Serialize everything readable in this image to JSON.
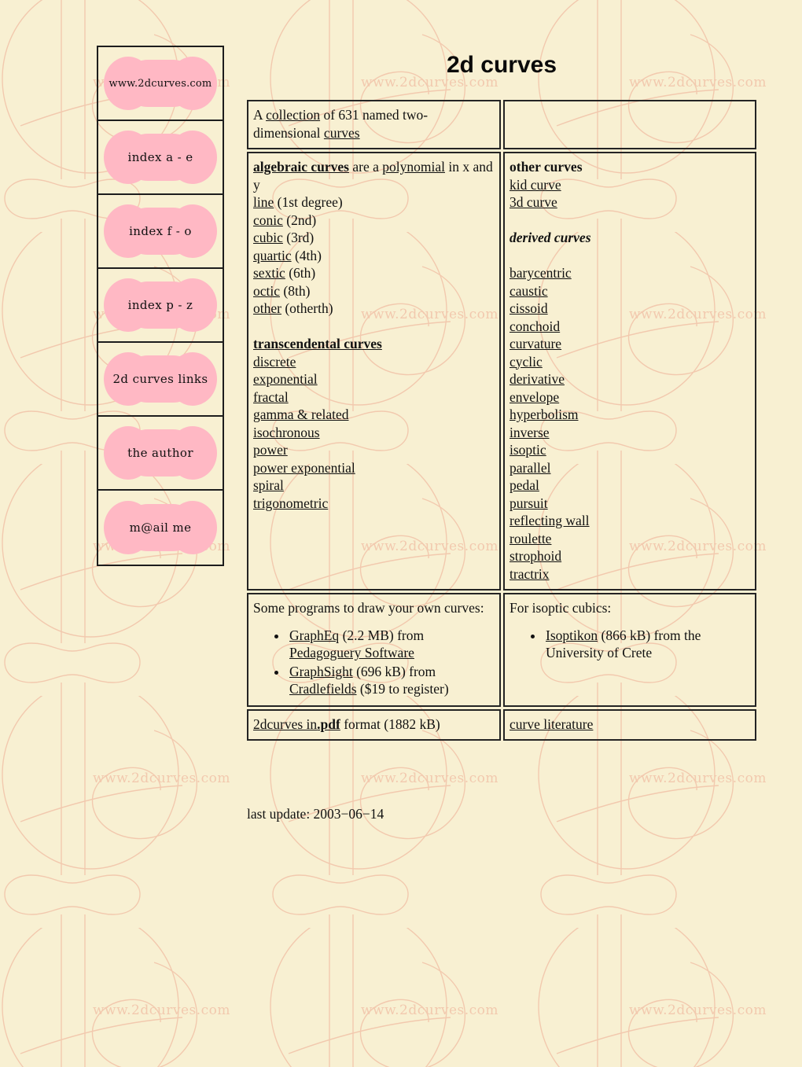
{
  "header": {
    "title": "2d curves"
  },
  "sidebar": {
    "items": [
      {
        "label": "www.2dcurves.com",
        "name": "home"
      },
      {
        "label": "index a - e",
        "name": "index-a-e"
      },
      {
        "label": "index f - o",
        "name": "index-f-o"
      },
      {
        "label": "index p - z",
        "name": "index-p-z"
      },
      {
        "label": "2d curves links",
        "name": "links"
      },
      {
        "label": "the author",
        "name": "author"
      },
      {
        "label": "m@ail me",
        "name": "mail"
      }
    ]
  },
  "intro": {
    "lead": "A",
    "link_collection": "collection",
    "middle": "of 631 named two-dimensional",
    "link_curves": "curves"
  },
  "algebraic": {
    "heading": "algebraic curves",
    "after_heading": "are a",
    "link_polynomial": "polynomial",
    "tail": "in x and y",
    "items": [
      {
        "link": "line",
        "note": "(1st degree)"
      },
      {
        "link": "conic",
        "note": "(2nd)"
      },
      {
        "link": "cubic",
        "note": "(3rd)"
      },
      {
        "link": "quartic",
        "note": "(4th)"
      },
      {
        "link": "sextic",
        "note": "(6th)"
      },
      {
        "link": "octic",
        "note": "(8th)"
      },
      {
        "link": "other",
        "note": "(otherth)"
      }
    ]
  },
  "transcendental": {
    "heading": "transcendental curves",
    "items": [
      "discrete",
      "exponential",
      "fractal",
      "gamma & related",
      "isochronous",
      "power",
      "power exponential",
      "spiral",
      "trigonometric"
    ]
  },
  "other_curves": {
    "heading": "other curves",
    "items": [
      "kid curve",
      "3d curve"
    ]
  },
  "derived_curves": {
    "heading": "derived curves",
    "items": [
      "barycentric",
      "caustic",
      "cissoid",
      "conchoid",
      "curvature",
      "cyclic",
      "derivative",
      "envelope",
      "hyperbolism",
      "inverse",
      "isoptic",
      "parallel",
      "pedal",
      "pursuit",
      "reflecting wall",
      "roulette",
      "strophoid",
      "tractrix"
    ]
  },
  "programs": {
    "intro": "Some programs to draw your own curves:",
    "items": [
      {
        "link1": "GraphEq",
        "size": "(2.2 MB)",
        "from": "from",
        "link2": "Pedagoguery Software",
        "note": ""
      },
      {
        "link1": "GraphSight",
        "size": "(696 kB)",
        "from": "from",
        "link2": "Cradlefields",
        "note": "($19 to register)"
      }
    ]
  },
  "isoptic": {
    "intro": "For isoptic cubics:",
    "items": [
      {
        "link1": "Isoptikon",
        "size": "(866 kB)",
        "from": "from the",
        "tail": "University of Crete"
      }
    ]
  },
  "footer_row": {
    "pdf_link": "2dcurves in",
    "pdf_bold": ".pdf",
    "pdf_tail": "format (1882 kB)",
    "literature": "curve literature"
  },
  "last_update": "last update: 2003−06−14",
  "watermark": {
    "text": "www.2dcurves.com"
  },
  "colors": {
    "page_background": "#f8f0d2",
    "watermark_line": "#f4ceb5",
    "button_pink": "#ffb8c4",
    "border": "#242424",
    "text": "#111111"
  }
}
